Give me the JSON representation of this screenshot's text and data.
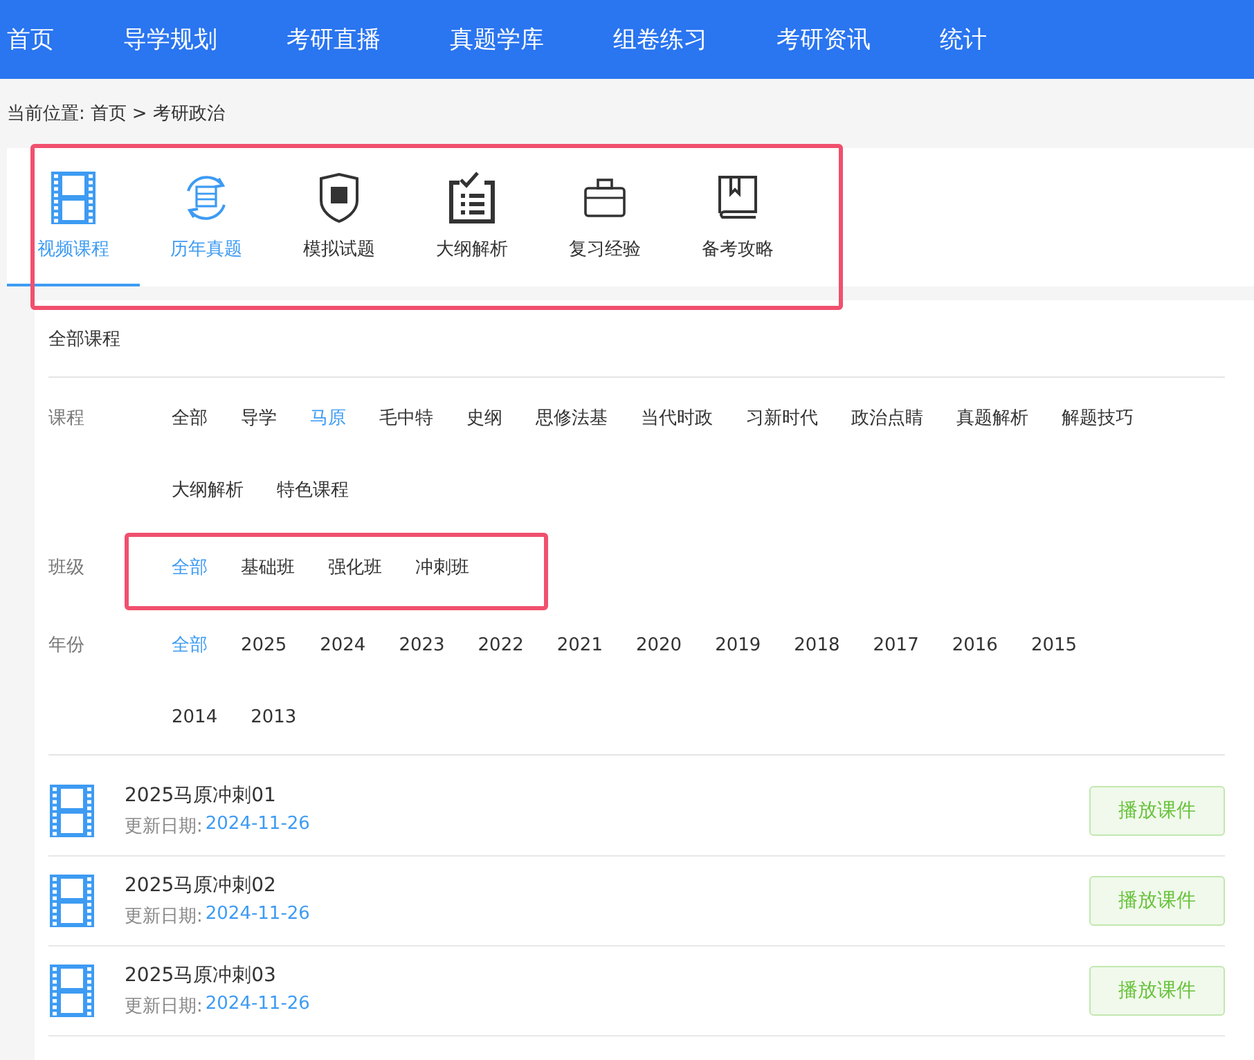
{
  "nav": [
    {
      "label": "首页",
      "selected": false
    },
    {
      "label": "导学规划",
      "selected": false
    },
    {
      "label": "考研直播",
      "selected": false
    },
    {
      "label": "真题学库",
      "selected": false
    },
    {
      "label": "组卷练习",
      "selected": false
    },
    {
      "label": "考研资讯",
      "selected": false
    },
    {
      "label": "统计",
      "selected": false
    }
  ],
  "breadcrumb": {
    "prefix": "当前位置:",
    "items": [
      "首页",
      "考研政治"
    ],
    "separator": ">"
  },
  "category_tabs": {
    "highlighted": true,
    "tabs": [
      {
        "label": "视频课程",
        "kind": "film",
        "selected": true,
        "hovered": false
      },
      {
        "label": "历年真题",
        "kind": "zhen",
        "selected": false,
        "hovered": true
      },
      {
        "label": "模拟试题",
        "kind": "mo",
        "selected": false,
        "hovered": false
      },
      {
        "label": "大纲解析",
        "kind": "checklist",
        "selected": false,
        "hovered": false
      },
      {
        "label": "复习经验",
        "kind": "briefcase",
        "selected": false,
        "hovered": false
      },
      {
        "label": "备考攻略",
        "kind": "book",
        "selected": false,
        "hovered": false
      }
    ]
  },
  "section_title": "全部课程",
  "filters": [
    {
      "label": "课程",
      "highlighted": false,
      "options": [
        {
          "text": "全部",
          "selected": false
        },
        {
          "text": "导学",
          "selected": false
        },
        {
          "text": "马原",
          "selected": true
        },
        {
          "text": "毛中特",
          "selected": false
        },
        {
          "text": "史纲",
          "selected": false
        },
        {
          "text": "思修法基",
          "selected": false
        },
        {
          "text": "当代时政",
          "selected": false
        },
        {
          "text": "习新时代",
          "selected": false
        },
        {
          "text": "政治点睛",
          "selected": false
        },
        {
          "text": "真题解析",
          "selected": false
        },
        {
          "text": "解题技巧",
          "selected": false
        },
        {
          "text": "大纲解析",
          "selected": false
        },
        {
          "text": "特色课程",
          "selected": false
        }
      ]
    },
    {
      "label": "班级",
      "highlighted": true,
      "options": [
        {
          "text": "全部",
          "selected": true
        },
        {
          "text": "基础班",
          "selected": false
        },
        {
          "text": "强化班",
          "selected": false
        },
        {
          "text": "冲刺班",
          "selected": false
        }
      ]
    },
    {
      "label": "年份",
      "highlighted": false,
      "options": [
        {
          "text": "全部",
          "selected": true
        },
        {
          "text": "2025",
          "selected": false
        },
        {
          "text": "2024",
          "selected": false
        },
        {
          "text": "2023",
          "selected": false
        },
        {
          "text": "2022",
          "selected": false
        },
        {
          "text": "2021",
          "selected": false
        },
        {
          "text": "2020",
          "selected": false
        },
        {
          "text": "2019",
          "selected": false
        },
        {
          "text": "2018",
          "selected": false
        },
        {
          "text": "2017",
          "selected": false
        },
        {
          "text": "2016",
          "selected": false
        },
        {
          "text": "2015",
          "selected": false
        },
        {
          "text": "2014",
          "selected": false
        },
        {
          "text": "2013",
          "selected": false
        }
      ]
    }
  ],
  "courses": [
    {
      "title": "2025马原冲刺01",
      "date_label": "更新日期:",
      "date": "2024-11-26",
      "button": "播放课件"
    },
    {
      "title": "2025马原冲刺02",
      "date_label": "更新日期:",
      "date": "2024-11-26",
      "button": "播放课件"
    },
    {
      "title": "2025马原冲刺03",
      "date_label": "更新日期:",
      "date": "2024-11-26",
      "button": "播放课件"
    }
  ]
}
